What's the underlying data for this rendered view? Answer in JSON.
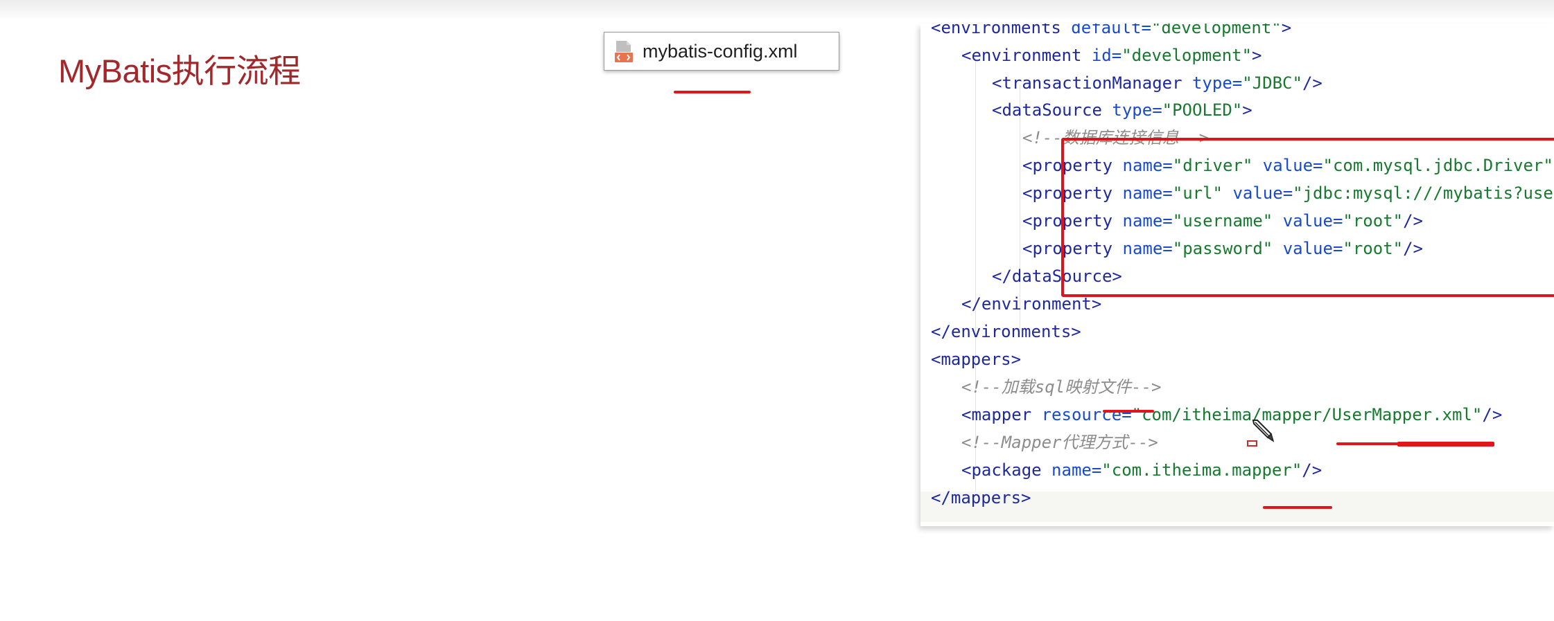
{
  "slide": {
    "title": "MyBatis执行流程"
  },
  "file_tab": {
    "name": "mybatis-config.xml",
    "icon": "xml-file-icon"
  },
  "editor": {
    "lines": [
      {
        "indent": 0,
        "parts": [
          [
            "t",
            "<environments "
          ],
          [
            "a",
            "default="
          ],
          [
            "v",
            "\"development\""
          ],
          [
            "t",
            ">"
          ]
        ]
      },
      {
        "indent": 1,
        "parts": [
          [
            "t",
            "<environment "
          ],
          [
            "a",
            "id="
          ],
          [
            "v",
            "\"development\""
          ],
          [
            "t",
            ">"
          ]
        ]
      },
      {
        "indent": 2,
        "parts": [
          [
            "t",
            "<transactionManager "
          ],
          [
            "a",
            "type="
          ],
          [
            "v",
            "\"JDBC\""
          ],
          [
            "t",
            "/>"
          ]
        ]
      },
      {
        "indent": 2,
        "parts": [
          [
            "t",
            "<dataSource "
          ],
          [
            "a",
            "type="
          ],
          [
            "v",
            "\"POOLED\""
          ],
          [
            "t",
            ">"
          ]
        ]
      },
      {
        "indent": 3,
        "parts": [
          [
            "c",
            "<!--数据库连接信息-->"
          ]
        ]
      },
      {
        "indent": 3,
        "parts": [
          [
            "t",
            "<property "
          ],
          [
            "a",
            "name="
          ],
          [
            "v",
            "\"driver\""
          ],
          [
            "t",
            " "
          ],
          [
            "a",
            "value="
          ],
          [
            "v",
            "\"com.mysql.jdbc.Driver\""
          ],
          [
            "t",
            "/>"
          ]
        ]
      },
      {
        "indent": 3,
        "parts": [
          [
            "t",
            "<property "
          ],
          [
            "a",
            "name="
          ],
          [
            "v",
            "\"url\""
          ],
          [
            "t",
            " "
          ],
          [
            "a",
            "value="
          ],
          [
            "v",
            "\"jdbc:mysql:///mybatis?useSSL=false\""
          ],
          [
            "t",
            "/>"
          ]
        ]
      },
      {
        "indent": 3,
        "parts": [
          [
            "t",
            "<property "
          ],
          [
            "a",
            "name="
          ],
          [
            "v",
            "\"username\""
          ],
          [
            "t",
            " "
          ],
          [
            "a",
            "value="
          ],
          [
            "v",
            "\"root\""
          ],
          [
            "t",
            "/>"
          ]
        ]
      },
      {
        "indent": 3,
        "parts": [
          [
            "t",
            "<property "
          ],
          [
            "a",
            "name="
          ],
          [
            "v",
            "\"password\""
          ],
          [
            "t",
            " "
          ],
          [
            "a",
            "value="
          ],
          [
            "v",
            "\"root\""
          ],
          [
            "t",
            "/>"
          ]
        ]
      },
      {
        "indent": 2,
        "parts": [
          [
            "t",
            "</dataSource>"
          ]
        ]
      },
      {
        "indent": 1,
        "parts": [
          [
            "t",
            "</environment>"
          ]
        ]
      },
      {
        "indent": 0,
        "parts": [
          [
            "t",
            "</environments>"
          ]
        ]
      },
      {
        "indent": 0,
        "parts": [
          [
            "t",
            "<mappers>"
          ]
        ]
      },
      {
        "indent": 1,
        "parts": [
          [
            "c",
            "<!--加载sql映射文件-->"
          ]
        ]
      },
      {
        "indent": 1,
        "parts": [
          [
            "t",
            "<mapper "
          ],
          [
            "a",
            "resource="
          ],
          [
            "v",
            "\"com/itheima/mapper/UserMapper.xml\""
          ],
          [
            "t",
            "/>"
          ]
        ]
      },
      {
        "indent": 1,
        "parts": [
          [
            "c",
            "<!--Mapper代理方式-->"
          ]
        ]
      },
      {
        "indent": 1,
        "parts": [
          [
            "t",
            "<package "
          ],
          [
            "a",
            "name="
          ],
          [
            "v",
            "\"com.itheima.mapper\""
          ],
          [
            "t",
            "/>"
          ]
        ]
      },
      {
        "indent": 0,
        "parts": [
          [
            "t",
            "</mappers>"
          ]
        ]
      }
    ]
  },
  "colors": {
    "title": "#a3282b",
    "annotation_red": "#dd151b",
    "xml_tag": "#1e28a0",
    "xml_attr": "#174ad4",
    "xml_value": "#167a2e",
    "xml_comment": "#8c8c8c"
  }
}
